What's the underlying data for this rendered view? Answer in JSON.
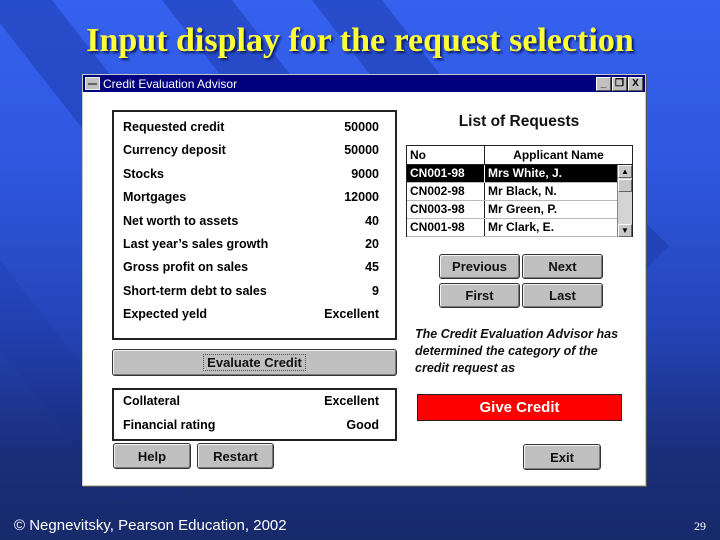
{
  "slide": {
    "title": "Input display for the request selection",
    "footer": "© Negnevitsky, Pearson Education, 2002",
    "page_number": "29"
  },
  "window": {
    "title": "Credit Evaluation Advisor",
    "controls": {
      "minimize": "_",
      "maximize": "❐",
      "close": "X"
    }
  },
  "inputs": [
    {
      "label": "Requested credit",
      "value": "50000"
    },
    {
      "label": "Currency deposit",
      "value": "50000"
    },
    {
      "label": "Stocks",
      "value": "9000"
    },
    {
      "label": "Mortgages",
      "value": "12000"
    },
    {
      "label": "Net worth to assets",
      "value": "40"
    },
    {
      "label": "Last year’s sales growth",
      "value": "20"
    },
    {
      "label": "Gross profit on sales",
      "value": "45"
    },
    {
      "label": "Short-term debt to sales",
      "value": "9"
    },
    {
      "label": "Expected yeld",
      "value": "Excellent"
    }
  ],
  "evaluate_button": "Evaluate Credit",
  "outputs": [
    {
      "label": "Collateral",
      "value": "Excellent"
    },
    {
      "label": "Financial rating",
      "value": "Good"
    }
  ],
  "requests": {
    "title": "List of Requests",
    "columns": [
      "No",
      "Applicant Name"
    ],
    "rows": [
      {
        "no": "CN001-98",
        "name": "Mrs White, J.",
        "selected": true
      },
      {
        "no": "CN002-98",
        "name": "Mr Black, N.",
        "selected": false
      },
      {
        "no": "CN003-98",
        "name": "Mr Green, P.",
        "selected": false
      },
      {
        "no": "CN001-98",
        "name": "Mr Clark, E.",
        "selected": false
      }
    ],
    "scroll_up": "▲",
    "scroll_down": "▼"
  },
  "nav": {
    "previous": "Previous",
    "next": "Next",
    "first": "First",
    "last": "Last"
  },
  "advisor_message": "The Credit  Evaluation  Advisor has determined the category of the credit request as",
  "result": {
    "label": "Give Credit",
    "color": "#ff0000"
  },
  "buttons": {
    "help": "Help",
    "restart": "Restart",
    "exit": "Exit"
  }
}
